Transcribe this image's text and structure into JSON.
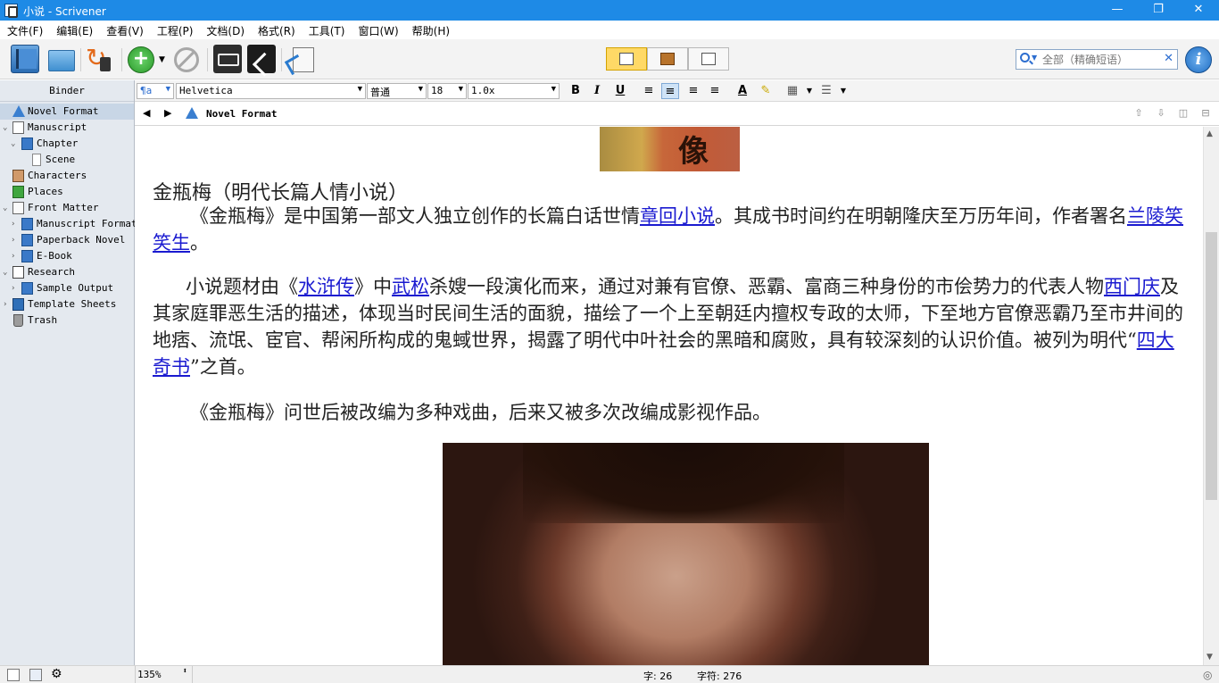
{
  "window": {
    "title": "小说 - Scrivener",
    "minimize": "—",
    "maximize": "❐",
    "close": "✕"
  },
  "menu": [
    "文件(F)",
    "编辑(E)",
    "查看(V)",
    "工程(P)",
    "文档(D)",
    "格式(R)",
    "工具(T)",
    "窗口(W)",
    "帮助(H)"
  ],
  "search": {
    "placeholder": "全部（精确短语）"
  },
  "formatbar": {
    "style": "¶a",
    "font": "Helvetica",
    "typeface": "普通",
    "size": "18",
    "spacing": "1.0x"
  },
  "binder": {
    "header": "Binder",
    "items": [
      {
        "label": "Novel Format"
      },
      {
        "label": "Manuscript"
      },
      {
        "label": "Chapter"
      },
      {
        "label": "Scene"
      },
      {
        "label": "Characters"
      },
      {
        "label": "Places"
      },
      {
        "label": "Front Matter"
      },
      {
        "label": "Manuscript Format"
      },
      {
        "label": "Paperback Novel"
      },
      {
        "label": "E-Book"
      },
      {
        "label": "Research"
      },
      {
        "label": "Sample Output"
      },
      {
        "label": "Template Sheets"
      },
      {
        "label": "Trash"
      }
    ]
  },
  "header": {
    "doc_title": "Novel Format"
  },
  "editor": {
    "image_caption_glyph": "像",
    "heading": "金瓶梅（明代长篇人情小说）",
    "p1": {
      "a": "《金瓶梅》是中国第一部文人独立创作的长篇白话世情",
      "link1": "章回小说",
      "b": "。其成书时间约在明朝隆庆至万历年间，作者署名",
      "link2": "兰陵笑笑生",
      "c": "。"
    },
    "p2": {
      "a": "小说题材由《",
      "link1": "水浒传",
      "b": "》中",
      "link2": "武松",
      "c": "杀嫂一段演化而来，通过对兼有官僚、恶霸、富商三种身份的市侩势力的代表人物",
      "link3": "西门庆",
      "d": "及其家庭罪恶生活的描述，体现当时民间生活的面貌，描绘了一个上至朝廷内擅权专政的太师，下至地方官僚恶霸乃至市井间的地痞、流氓、宦官、帮闲所构成的鬼蜮世界，揭露了明代中叶社会的黑暗和腐败，具有较深刻的认识价值。被列为明代“",
      "link4": "四大奇书",
      "e": "”之首。"
    },
    "p3": "《金瓶梅》问世后被改编为多种戏曲，后来又被多次改编成影视作品。"
  },
  "footer": {
    "zoom": "135%",
    "words": "字: 26",
    "chars": "字符: 276"
  }
}
